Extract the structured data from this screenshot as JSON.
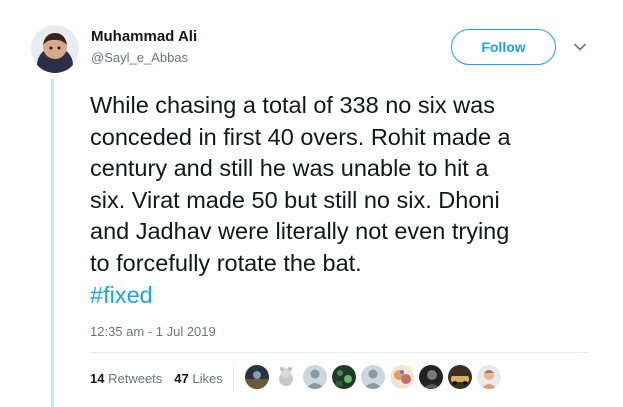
{
  "author": {
    "name": "Muhammad Ali",
    "handle": "@Sayl_e_Abbas"
  },
  "follow_label": "Follow",
  "tweet": {
    "text": "While chasing a total of 338 no six was\nconceded in first 40 overs. Rohit made a\ncentury and still he was unable to hit a\nsix. Virat made 50 but still no six. Dhoni\nand Jadhav were literally not even trying\nto forcefully rotate the bat.",
    "hashtag": "#fixed",
    "timestamp": "12:35 am - 1 Jul 2019"
  },
  "stats": {
    "retweets_count": "14",
    "retweets_label": "Retweets",
    "likes_count": "47",
    "likes_label": "Likes"
  },
  "colors": {
    "accent": "#1da1f2",
    "secondary_text": "#657786",
    "thread_line": "#c4e4f7"
  },
  "likers": [
    {
      "icon": "avatar-dark-landscape"
    },
    {
      "icon": "avatar-teddy-bear"
    },
    {
      "icon": "avatar-default"
    },
    {
      "icon": "avatar-green-pattern"
    },
    {
      "icon": "avatar-default"
    },
    {
      "icon": "avatar-colorful"
    },
    {
      "icon": "avatar-dark-portrait"
    },
    {
      "icon": "avatar-car"
    },
    {
      "icon": "avatar-light-portrait"
    }
  ]
}
